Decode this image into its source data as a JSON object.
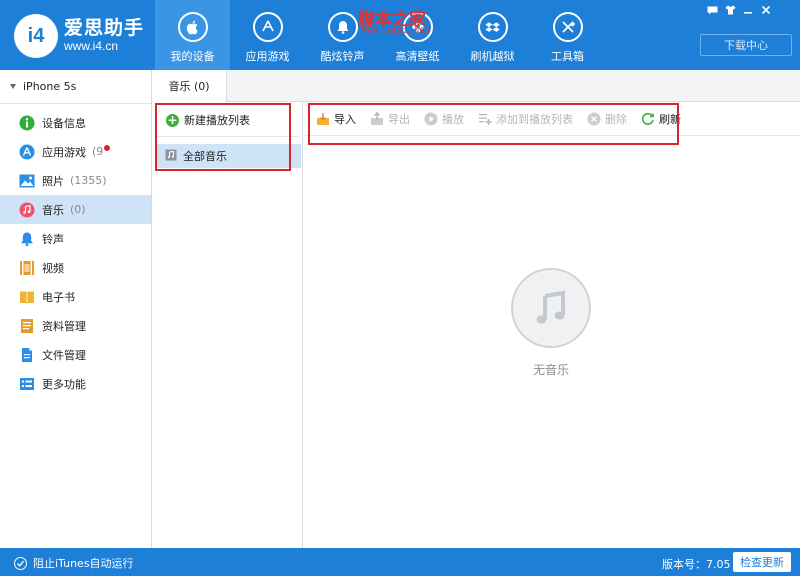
{
  "brand": {
    "name": "爱思助手",
    "url": "www.i4.cn",
    "logo_text": "i4"
  },
  "watermark": {
    "main": "脚本之家",
    "sub": "WWW.JB51.NET"
  },
  "nav": [
    {
      "label": "我的设备",
      "icon": "apple-icon",
      "active": true
    },
    {
      "label": "应用游戏",
      "icon": "app-store-icon",
      "active": false
    },
    {
      "label": "酷炫铃声",
      "icon": "bell-icon",
      "active": false
    },
    {
      "label": "高清壁纸",
      "icon": "flower-icon",
      "active": false
    },
    {
      "label": "刷机越狱",
      "icon": "dropbox-icon",
      "active": false
    },
    {
      "label": "工具箱",
      "icon": "tools-icon",
      "active": false
    }
  ],
  "window_controls": [
    "message-icon",
    "shirt-icon",
    "minimize-icon",
    "close-icon"
  ],
  "download_center": "下载中心",
  "device": {
    "name": "iPhone 5s"
  },
  "sidebar": {
    "items": [
      {
        "label": "设备信息",
        "count": "",
        "icon": "info-icon",
        "color": "#2fae3c",
        "active": false,
        "badge": false
      },
      {
        "label": "应用游戏",
        "count": "(9",
        "icon": "app-store-icon",
        "color": "#2a8ee6",
        "active": false,
        "badge": true
      },
      {
        "label": "照片",
        "count": "(1355)",
        "icon": "photo-icon",
        "color": "#2b8fe6",
        "active": false,
        "badge": false
      },
      {
        "label": "音乐",
        "count": "(0)",
        "icon": "music-icon",
        "color": "#f0506e",
        "active": true,
        "badge": false
      },
      {
        "label": "铃声",
        "count": "",
        "icon": "bell-icon",
        "color": "#2a8ee6",
        "active": false,
        "badge": false
      },
      {
        "label": "视频",
        "count": "",
        "icon": "video-icon",
        "color": "#e39a2e",
        "active": false,
        "badge": false
      },
      {
        "label": "电子书",
        "count": "",
        "icon": "book-icon",
        "color": "#f0b332",
        "active": false,
        "badge": false
      },
      {
        "label": "资料管理",
        "count": "",
        "icon": "contacts-icon",
        "color": "#e39a2e",
        "active": false,
        "badge": false
      },
      {
        "label": "文件管理",
        "count": "",
        "icon": "file-icon",
        "color": "#2a8ee6",
        "active": false,
        "badge": false
      },
      {
        "label": "更多功能",
        "count": "",
        "icon": "more-icon",
        "color": "#2a8ee6",
        "active": false,
        "badge": false
      }
    ]
  },
  "tab": {
    "label": "音乐 (0)"
  },
  "playlist": {
    "new_label": "新建播放列表",
    "all_label": "全部音乐"
  },
  "toolbar": [
    {
      "label": "导入",
      "icon": "import-icon",
      "enabled": true
    },
    {
      "label": "导出",
      "icon": "export-icon",
      "enabled": false
    },
    {
      "label": "播放",
      "icon": "play-icon",
      "enabled": false
    },
    {
      "label": "添加到播放列表",
      "icon": "add-to-playlist-icon",
      "enabled": false
    },
    {
      "label": "删除",
      "icon": "delete-icon",
      "enabled": false
    },
    {
      "label": "刷新",
      "icon": "refresh-icon",
      "enabled": true
    }
  ],
  "empty_state": {
    "text": "无音乐"
  },
  "statusbar": {
    "itunes_label": "阻止iTunes自动运行",
    "version": "版本号：7.05",
    "check_update": "检查更新"
  },
  "colors": {
    "header": "#1d7fd8",
    "selection": "#cfe3f7",
    "annotation": "#d7262c"
  }
}
